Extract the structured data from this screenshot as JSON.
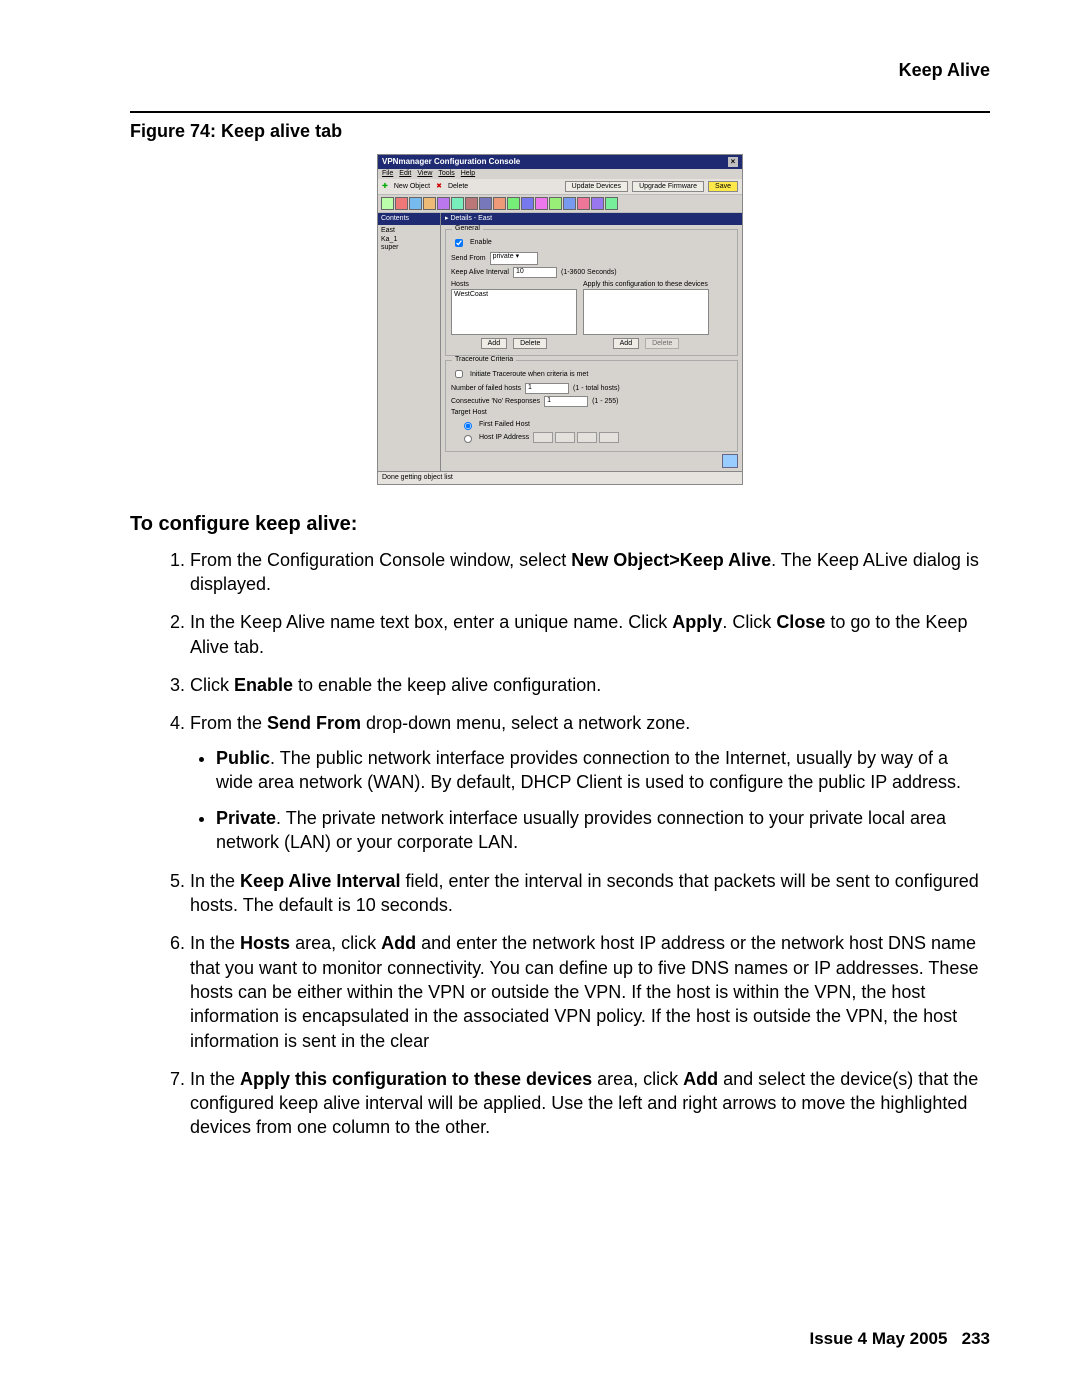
{
  "header": {
    "title": "Keep Alive"
  },
  "figure": {
    "caption": "Figure 74: Keep alive tab"
  },
  "app": {
    "title": "VPNmanager Configuration Console",
    "menu": {
      "file": "File",
      "edit": "Edit",
      "view": "View",
      "tools": "Tools",
      "help": "Help"
    },
    "toolbar_row": {
      "new_object": "New Object",
      "delete": "Delete",
      "update_devices": "Update Devices",
      "upgrade_firmware": "Upgrade Firmware",
      "save": "Save"
    },
    "side": {
      "header": "Contents",
      "items": [
        "East",
        "Ka_1",
        "super"
      ]
    },
    "main": {
      "header": "Details - East",
      "general": {
        "legend": "General",
        "enable": "Enable",
        "send_from_label": "Send From",
        "send_from_value": "private",
        "interval_label": "Keep Alive Interval",
        "interval_value": "10",
        "interval_hint": "(1-3600 Seconds)",
        "hosts_label": "Hosts",
        "hosts_item": "WestCoast",
        "apply_label": "Apply this configuration to these devices",
        "add": "Add",
        "delete": "Delete",
        "add2": "Add",
        "delete2": "Delete"
      },
      "trace": {
        "legend": "Traceroute Criteria",
        "initiate": "Initiate Traceroute when criteria is met",
        "num_failed_label": "Number of failed hosts",
        "num_failed_value": "1",
        "num_failed_hint": "(1 - total hosts)",
        "consec_label": "Consecutive 'No' Responses",
        "consec_value": "1",
        "consec_hint": "(1 - 255)",
        "target_label": "Target Host",
        "first_failed": "First Failed Host",
        "host_ip": "Host IP Address"
      }
    },
    "status": "Done getting object list"
  },
  "doc": {
    "subhead": "To configure keep alive:",
    "s1a": "From the Configuration Console window, select ",
    "s1b": "New Object>Keep Alive",
    "s1c": ". The Keep ALive dialog is displayed.",
    "s2a": "In the Keep Alive name text box, enter a unique name. Click ",
    "s2b": "Apply",
    "s2c": ". Click ",
    "s2d": "Close",
    "s2e": " to go to the Keep Alive tab.",
    "s3a": "Click ",
    "s3b": "Enable",
    "s3c": " to enable the keep alive configuration.",
    "s4a": "From the ",
    "s4b": "Send From",
    "s4c": " drop-down menu, select a network zone.",
    "bpub_b": "Public",
    "bpub_t": ". The public network interface provides connection to the Internet, usually by way of a wide area network (WAN). By default, DHCP Client is used to configure the public IP address.",
    "bpriv_b": "Private",
    "bpriv_t": ". The private network interface usually provides connection to your private local area network (LAN) or your corporate LAN.",
    "s5a": "In the ",
    "s5b": "Keep Alive Interval",
    "s5c": " field, enter the interval in seconds that packets will be sent to configured hosts. The default is 10 seconds.",
    "s6a": "In the ",
    "s6b": "Hosts",
    "s6c": " area, click ",
    "s6d": "Add",
    "s6e": " and enter the network host IP address or the network host DNS name that you want to monitor connectivity. You can define up to five DNS names or IP addresses. These hosts can be either within the VPN or outside the VPN. If the host is within the VPN, the host information is encapsulated in the associated VPN policy. If the host is outside the VPN, the host information is sent in the clear",
    "s7a": "In the ",
    "s7b": "Apply this configuration to these devices",
    "s7c": " area, click ",
    "s7d": "Add",
    "s7e": " and select the device(s) that the configured keep alive interval will be applied. Use the left and right arrows to move the highlighted devices from one column to the other."
  },
  "footer": {
    "issue": "Issue 4   May 2005",
    "page": "233"
  }
}
